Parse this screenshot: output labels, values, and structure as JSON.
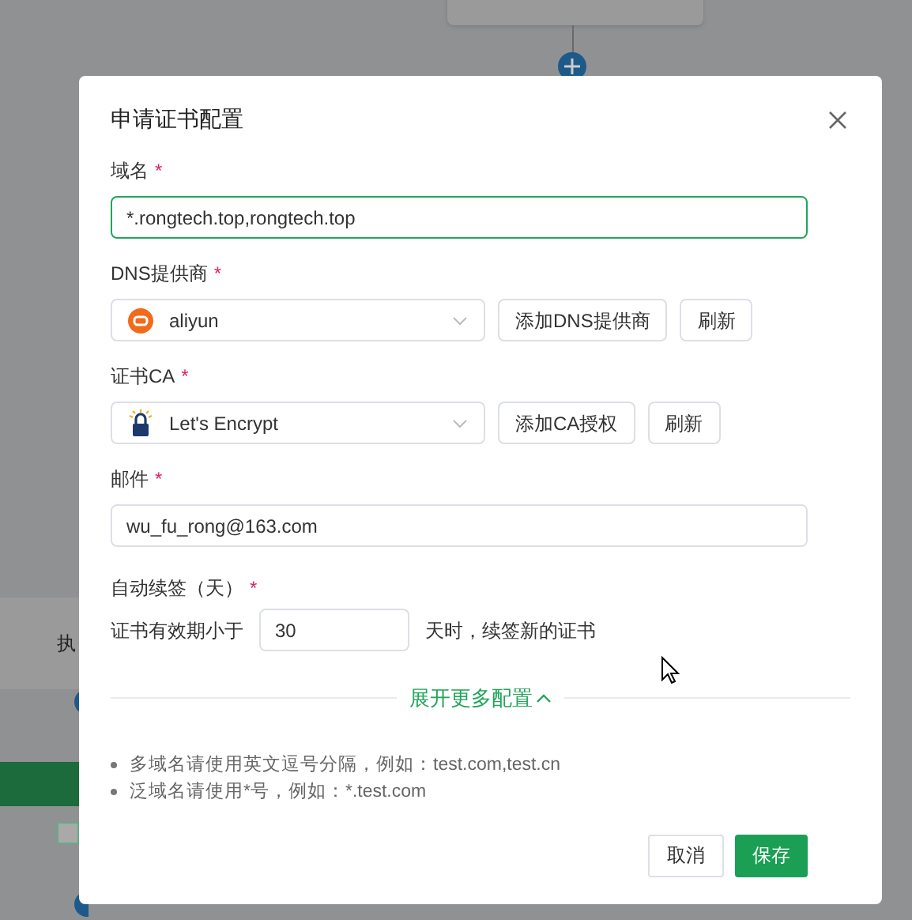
{
  "background": {
    "text": "执"
  },
  "dialog": {
    "title": "申请证书配置",
    "fields": [
      {
        "kind": "input",
        "label": "域名",
        "required_mark": "*",
        "value": "*.rongtech.top,rongtech.top",
        "focused": true
      },
      {
        "kind": "select",
        "label": "DNS提供商",
        "required_mark": "*",
        "value": "aliyun",
        "buttons": [
          "添加DNS提供商",
          "刷新"
        ]
      },
      {
        "kind": "select",
        "label": "证书CA",
        "required_mark": "*",
        "value": "Let's Encrypt",
        "buttons": [
          "添加CA授权",
          "刷新"
        ]
      },
      {
        "kind": "input",
        "label": "邮件",
        "required_mark": "*",
        "value": "wu_fu_rong@163.com",
        "focused": false
      }
    ],
    "renewal": {
      "label": "自动续签（天）",
      "required_mark": "*",
      "prefix": "证书有效期小于",
      "value": "30",
      "suffix": "天时，续签新的证书"
    },
    "expand_link": "展开更多配置",
    "tips": [
      "多域名请使用英文逗号分隔，例如：test.com,test.cn",
      "泛域名请使用*号，例如：*.test.com"
    ],
    "buttons": [
      {
        "label": "取消",
        "kind": "default"
      },
      {
        "label": "保存",
        "kind": "primary"
      }
    ]
  }
}
